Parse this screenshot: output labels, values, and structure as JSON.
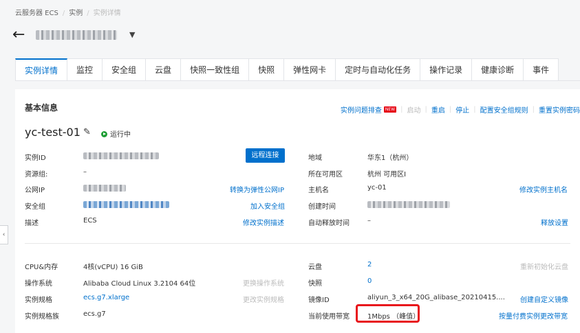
{
  "breadcrumb": [
    "云服务器 ECS",
    "实例",
    "实例详情"
  ],
  "tabs": [
    "实例详情",
    "监控",
    "安全组",
    "云盘",
    "快照一致性组",
    "快照",
    "弹性网卡",
    "定时与自动化任务",
    "操作记录",
    "健康诊断",
    "事件"
  ],
  "section_title": "基本信息",
  "actions": {
    "troubleshoot": "实例问题排查",
    "new_badge": "NEW",
    "start": "启动",
    "restart": "重启",
    "stop": "停止",
    "config_sg_rules": "配置安全组规则",
    "reset_password": "重置实例密码"
  },
  "instance": {
    "name": "yc-test-01",
    "status": "运行中"
  },
  "info": {
    "instance_id_label": "实例ID",
    "remote_connect": "远程连接",
    "resource_group_label": "资源组:",
    "resource_group_value": "–",
    "public_ip_label": "公网IP",
    "convert_eip": "转换为弹性公网IP",
    "security_group_label": "安全组",
    "join_sg": "加入安全组",
    "desc_label": "描述",
    "desc_value": "ECS",
    "modify_desc": "修改实例描述",
    "region_label": "地域",
    "region_value": "华东1（杭州）",
    "zone_label": "所在可用区",
    "zone_value": "杭州 可用区I",
    "hostname_label": "主机名",
    "hostname_value": "yc-01",
    "modify_hostname": "修改实例主机名",
    "created_label": "创建时间",
    "auto_release_label": "自动释放时间",
    "auto_release_value": "–",
    "release_settings": "释放设置"
  },
  "config": {
    "cpu_mem_label": "CPU&内存",
    "cpu_mem_value": "4核(vCPU) 16 GiB",
    "os_label": "操作系统",
    "os_value": "Alibaba Cloud Linux 3.2104 64位",
    "change_os": "更换操作系统",
    "spec_label": "实例规格",
    "spec_value": "ecs.g7.xlarge",
    "change_spec": "更改实例规格",
    "family_label": "实例规格族",
    "family_value": "ecs.g7",
    "disk_label": "云盘",
    "disk_value": "2",
    "reinit_disk": "重新初始化云盘",
    "snapshot_label": "快照",
    "snapshot_value": "0",
    "image_label": "镜像ID",
    "image_value": "aliyun_3_x64_20G_alibase_20210415....",
    "create_image": "创建自定义镜像",
    "bandwidth_label": "当前使用带宽",
    "bandwidth_value": "1Mbps （峰值）",
    "change_bandwidth": "按量付费实例更改带宽"
  },
  "colors": {
    "accent": "#0070cc",
    "running": "#1e9e34",
    "highlight": "#e8141b"
  },
  "icons": {
    "back": "arrow-left-icon",
    "caret": "caret-down-icon",
    "edit": "pencil-icon",
    "collapse": "chevron-left-icon"
  }
}
